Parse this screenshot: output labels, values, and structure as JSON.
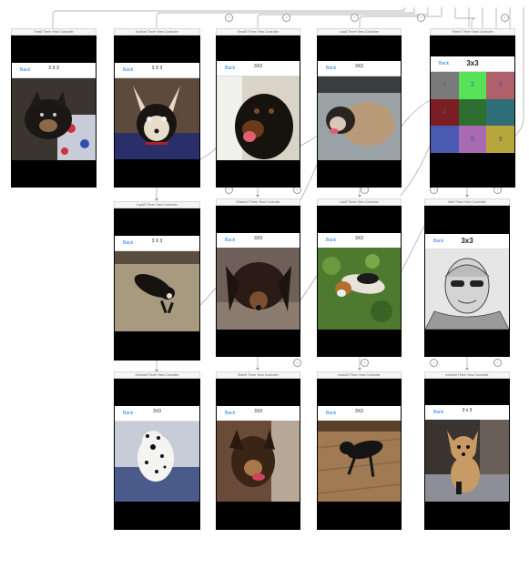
{
  "scenes": [
    {
      "title": "Small Three View Controller",
      "back": "Back",
      "nav": "3 X 3"
    },
    {
      "title": "Android Three View Controller",
      "back": "Back",
      "nav": "3 X 3"
    },
    {
      "title": "Small2 Three View Controller",
      "back": "Back",
      "nav": "3X3"
    },
    {
      "title": "Lisa3 Three View Controller",
      "back": "Back",
      "nav": "3X3"
    },
    {
      "title": "Three3 Three View Controller",
      "back": "Back",
      "nav": "3x3"
    },
    {
      "title": "Lapis3 Three View Controller",
      "back": "Back",
      "nav": "3 X 3"
    },
    {
      "title": "Shanks3 Three View Controller",
      "back": "Back",
      "nav": "3X3"
    },
    {
      "title": "Lisa3 Three View Controller",
      "back": "Back",
      "nav": "3X3"
    },
    {
      "title": "Well Three View Controller",
      "back": "Back",
      "nav": "3x3"
    },
    {
      "title": "Emerald Three View Controller",
      "back": "Back",
      "nav": "3X3"
    },
    {
      "title": "Sheriff Three View Controller",
      "back": "Back",
      "nav": "3X3"
    },
    {
      "title": "Inland3 Three View Controller",
      "back": "Back",
      "nav": "3X3"
    },
    {
      "title": "Inched3 Three View Controller",
      "back": "Back",
      "nav": "3 x 3"
    }
  ],
  "grid": {
    "cells": [
      "1",
      "2",
      "3",
      "4",
      "5",
      "6",
      "7",
      "8",
      "9"
    ],
    "colors": [
      "#7a7a7a",
      "#58e258",
      "#b0606a",
      "#7a1e24",
      "#2e6e2e",
      "#2f6f77",
      "#4a5ab0",
      "#a86ab0",
      "#b7a63c"
    ]
  },
  "wire_labels": [
    "1",
    "1",
    "1",
    "1",
    "1",
    "1",
    "1",
    "1",
    "1",
    "1",
    "1",
    "1",
    "1",
    "1"
  ],
  "colors": {
    "link": "#1a7cf2",
    "screen": "#000000",
    "wire": "#999999"
  }
}
